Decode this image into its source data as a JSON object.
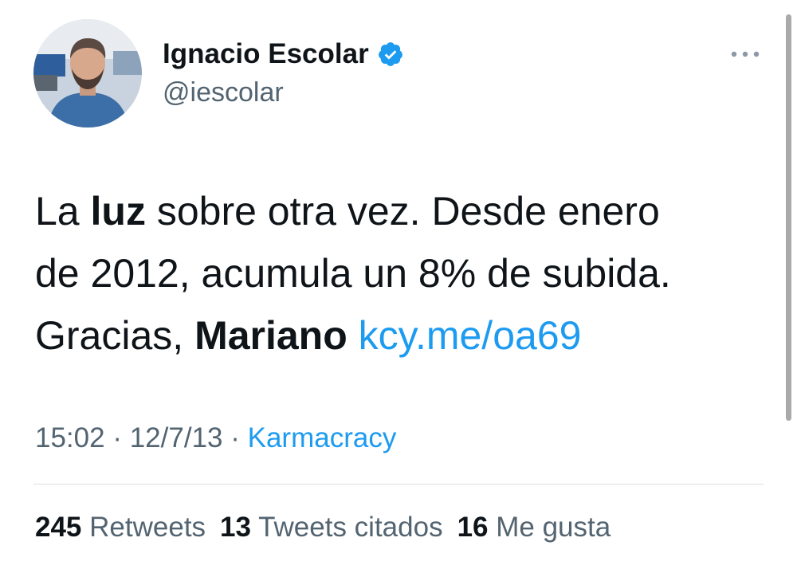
{
  "author": {
    "display_name": "Ignacio Escolar",
    "handle": "@iescolar",
    "verified_icon": "verified-badge-icon"
  },
  "tweet": {
    "text_parts": [
      {
        "text": "La ",
        "style": "normal"
      },
      {
        "text": "luz",
        "style": "bold"
      },
      {
        "text": " sobre otra vez. Desde enero",
        "style": "normal"
      },
      {
        "text": "de 2012, acumula un 8% de subida.",
        "style": "normal"
      },
      {
        "text": "Gracias, ",
        "style": "normal"
      },
      {
        "text": "Mariano",
        "style": "bold"
      },
      {
        "text": " ",
        "style": "normal"
      },
      {
        "text": "kcy.me/oa69",
        "style": "link"
      }
    ],
    "time": "15:02",
    "date": "12/7/13",
    "separator": "·",
    "source": "Karmacracy"
  },
  "stats": {
    "retweets_count": "245",
    "retweets_label": "Retweets",
    "quotes_count": "13",
    "quotes_label": "Tweets citados",
    "likes_count": "16",
    "likes_label": "Me gusta"
  },
  "colors": {
    "link": "#1d9bf0",
    "secondary_text": "#536471",
    "primary_text": "#0f1419"
  }
}
